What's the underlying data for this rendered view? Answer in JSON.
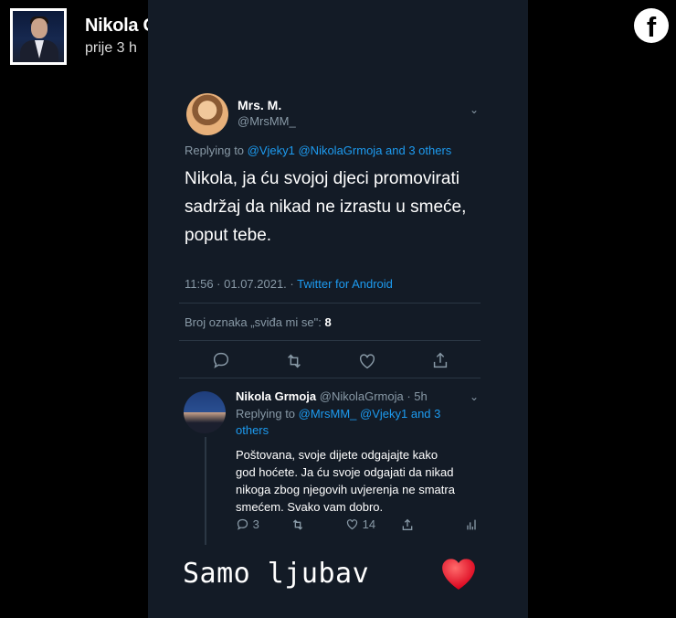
{
  "header": {
    "name": "Nikola Grmoja",
    "time": "prije 3 h",
    "logo": "facebook-icon"
  },
  "tweet": {
    "name": "Mrs. M.",
    "handle": "@MrsMM_",
    "replying_prefix": "Replying to ",
    "replying_to": "@Vjeky1 @NikolaGrmoja and 3 others",
    "lines": [
      "Nikola, ja ću svojoj djeci promovirati",
      "sadržaj da nikad ne izrastu u smeće,",
      "poput tebe."
    ],
    "timestamp": "11:56 · 01.07.2021. · ",
    "source": "Twitter for Android",
    "likes_label": "Broj oznaka „sviđa mi se\": ",
    "likes_count": "8",
    "actions": [
      "reply-icon",
      "retweet-icon",
      "like-icon",
      "share-icon"
    ]
  },
  "reply": {
    "name": "Nikola Grmoja",
    "meta": "@NikolaGrmoja · 5h",
    "replying_prefix": "Replying to ",
    "replying_to": "@MrsMM_ @Vjeky1 and 3 others",
    "lines": [
      "Poštovana, svoje dijete odgajajte kako",
      "god hoćete. Ja ću svoje odgajati da nikad",
      "nikoga zbog njegovih uvjerenja ne smatra",
      "smećem. Svako vam dobro."
    ],
    "reply_count": "3",
    "like_count": "14"
  },
  "caption": {
    "text": "Samo ljubav",
    "emoji": "red-heart"
  }
}
